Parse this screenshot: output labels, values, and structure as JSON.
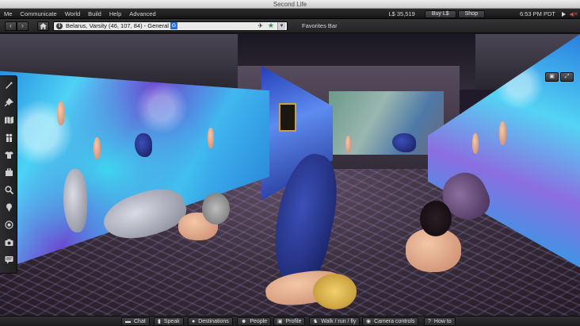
{
  "window": {
    "title": "Second Life"
  },
  "menubar": {
    "items": [
      "Me",
      "Communicate",
      "World",
      "Build",
      "Help",
      "Advanced"
    ],
    "balance": "L$ 35,519",
    "buy_label": "Buy L$",
    "shop_label": "Shop",
    "clock": "6:53 PM PDT",
    "icons": [
      "media-play-icon",
      "speaker-muted-icon"
    ]
  },
  "navbar": {
    "back_icon": "back-arrow-icon",
    "forward_icon": "forward-arrow-icon",
    "home_icon": "home-icon",
    "location": "Belarus, Varsity (46, 107, 84) - General",
    "maturity_badge": "G",
    "favorites_label": "Favorites Bar"
  },
  "sidebar": {
    "items": [
      "build-icon",
      "pick-icon",
      "map-icon",
      "people-icon",
      "appearance-icon",
      "inventory-icon",
      "search-icon",
      "landmark-icon",
      "voice-icon",
      "snapshot-icon",
      "chat-history-icon"
    ]
  },
  "bottombar": {
    "buttons": [
      {
        "label": "Chat",
        "icon": "chat-icon"
      },
      {
        "label": "Speak",
        "icon": "microphone-icon"
      },
      {
        "label": "Destinations",
        "icon": "destination-pin-icon"
      },
      {
        "label": "People",
        "icon": "people-icon"
      },
      {
        "label": "Profile",
        "icon": "profile-icon"
      },
      {
        "label": "Walk / run / fly",
        "icon": "walk-icon"
      },
      {
        "label": "Camera controls",
        "icon": "camera-eye-icon"
      },
      {
        "label": "How to",
        "icon": "help-icon"
      }
    ]
  },
  "colors": {
    "location_badge": "#2f6fcc",
    "favorite_star": "#2b9a4c",
    "chrome_dark": "#1c1c1e"
  }
}
